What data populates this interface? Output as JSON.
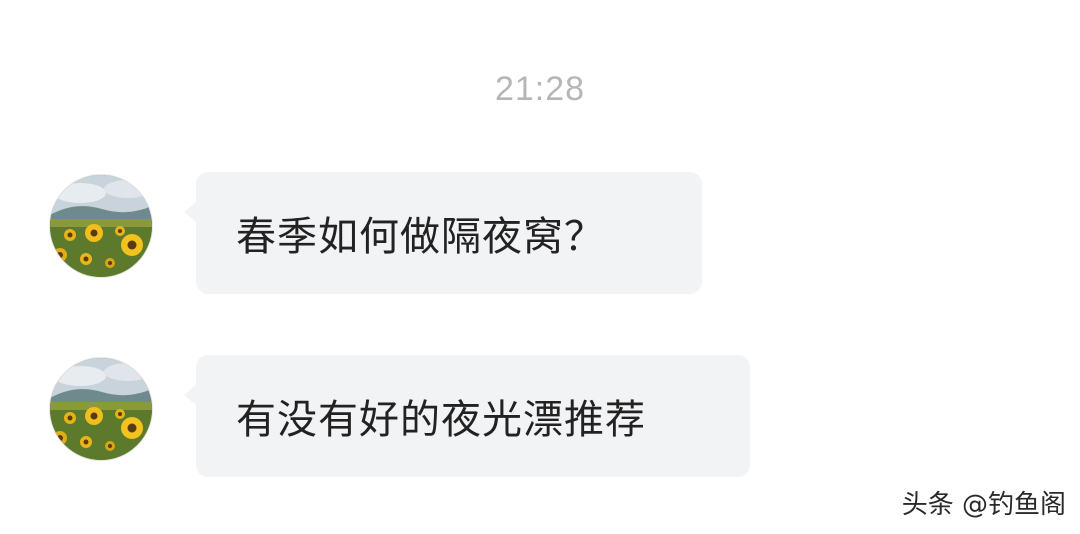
{
  "chat": {
    "timestamp": "21:28",
    "messages": [
      {
        "sender_avatar": "sunflower-field-avatar",
        "text": "春季如何做隔夜窝？"
      },
      {
        "sender_avatar": "sunflower-field-avatar",
        "text": "有没有好的夜光漂推荐"
      }
    ]
  },
  "watermark": "头条 @钓鱼阁",
  "colors": {
    "background": "#ffffff",
    "bubble": "#f2f3f5",
    "timestamp": "#b6b6b6",
    "message_text": "#222222"
  }
}
